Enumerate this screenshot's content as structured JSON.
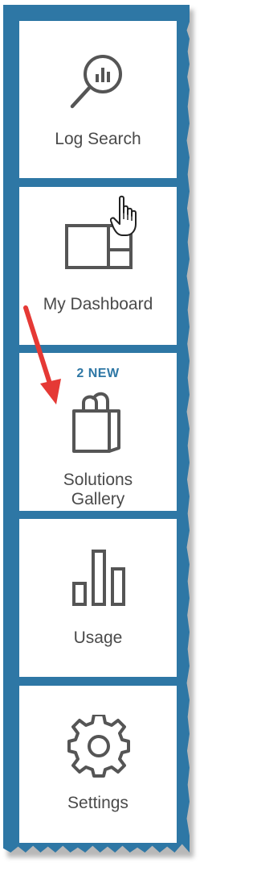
{
  "nav": {
    "items": [
      {
        "label": "Log Search",
        "icon": "log-search-icon"
      },
      {
        "label": "My Dashboard",
        "icon": "dashboard-icon"
      },
      {
        "label_line1": "Solutions",
        "label_line2": "Gallery",
        "badge": "2 NEW",
        "icon": "shopping-bag-icon"
      },
      {
        "label": "Usage",
        "icon": "bar-chart-icon"
      },
      {
        "label": "Settings",
        "icon": "gear-icon"
      }
    ]
  },
  "colors": {
    "rail": "#2e77a5",
    "badge": "#2e77a5",
    "icon_stroke": "#555555",
    "label": "#4a4a4a",
    "annotation_arrow": "#e53935"
  },
  "annotations": {
    "arrow": "red-arrow-pointing-to-solutions-gallery",
    "cursor": "hand-pointer-cursor"
  }
}
